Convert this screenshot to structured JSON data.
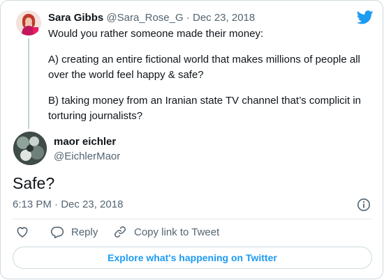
{
  "parent_tweet": {
    "author_name": "Sara Gibbs",
    "author_handle": "@Sara_Rose_G",
    "separator": " · ",
    "date": "Dec 23, 2018",
    "paragraphs": [
      "Would you rather someone made their money:",
      "A) creating an entire fictional world that makes millions of people all over the world feel happy & safe?",
      "B) taking money from an Iranian state TV channel that’s complicit in torturing journalists?"
    ]
  },
  "tweet": {
    "author_name": "maor eichler",
    "author_handle": "@EichlerMaor",
    "text": "Safe?",
    "timestamp": "6:13 PM · Dec 23, 2018"
  },
  "actions": {
    "reply_label": "Reply",
    "copy_link_label": "Copy link to Tweet"
  },
  "footer": {
    "explore_label": "Explore what's happening on Twitter"
  },
  "colors": {
    "accent": "#1d9bf0",
    "muted_text": "#536471",
    "border": "#cfd9de"
  },
  "icons": {
    "logo": "twitter-bird-icon",
    "info": "info-icon",
    "like": "heart-icon",
    "reply": "speech-bubble-icon",
    "copy": "link-icon"
  }
}
